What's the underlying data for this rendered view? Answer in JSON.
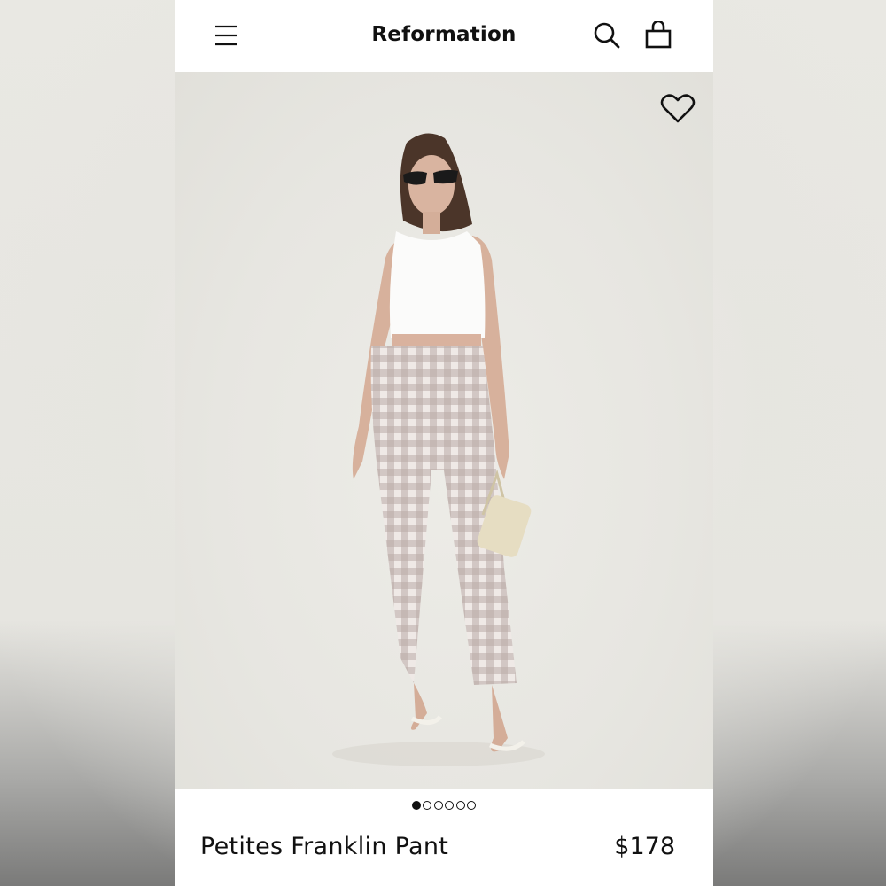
{
  "header": {
    "brand": "Reformation",
    "menu_icon": "hamburger-menu-icon",
    "search_icon": "search-icon",
    "bag_icon": "shopping-bag-icon"
  },
  "hero": {
    "favorite_icon": "heart-outline-icon",
    "image_subject": "model wearing white crop tank and gingham straight-leg pants with cream handbag"
  },
  "carousel": {
    "total": 6,
    "active_index": 0
  },
  "product": {
    "name": "Petites Franklin Pant",
    "price": "$178"
  },
  "colors": {
    "text": "#111111",
    "background": "#ffffff",
    "hero_bg": "#e8e7e2"
  }
}
